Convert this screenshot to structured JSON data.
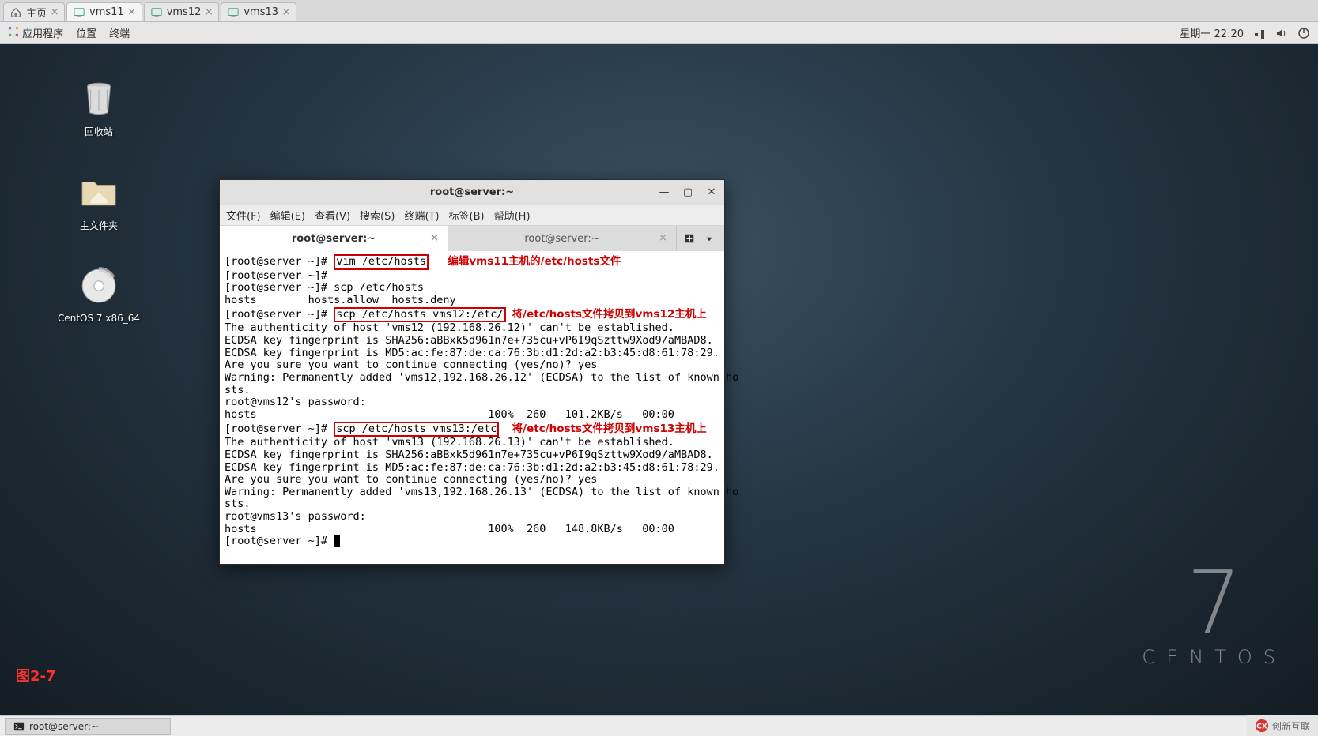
{
  "browser_tabs": [
    {
      "label": "主页",
      "icon": "home"
    },
    {
      "label": "vms11",
      "icon": "vm",
      "active": true
    },
    {
      "label": "vms12",
      "icon": "vm"
    },
    {
      "label": "vms13",
      "icon": "vm"
    }
  ],
  "top_panel": {
    "applications": "应用程序",
    "places": "位置",
    "terminal": "终端",
    "clock": "星期一 22:20"
  },
  "desktop_icons": {
    "trash": "回收站",
    "home": "主文件夹",
    "centos": "CentOS 7 x86_64"
  },
  "centos_watermark": {
    "seven": "7",
    "text": "CENTOS"
  },
  "figure_label": "图2-7",
  "terminal": {
    "title": "root@server:~",
    "menu": {
      "file": "文件(F)",
      "edit": "编辑(E)",
      "view": "查看(V)",
      "search": "搜索(S)",
      "terminal": "终端(T)",
      "tabs": "标签(B)",
      "help": "帮助(H)"
    },
    "tabs": [
      {
        "label": "root@server:~",
        "active": true
      },
      {
        "label": "root@server:~"
      }
    ],
    "prompt": "[root@server ~]#",
    "cmd1": "vim /etc/hosts",
    "anno1": "编辑vms11主机的/etc/hosts文件",
    "line_scp_partial": "[root@server ~]# scp /etc/hosts",
    "line_hosts_variants": "hosts        hosts.allow  hosts.deny",
    "cmd2": "scp /etc/hosts vms12:/etc/",
    "anno2": "将/etc/hosts文件拷贝到vms12主机上",
    "auth12": "The authenticity of host 'vms12 (192.168.26.12)' can't be established.",
    "ecdsa_sha": "ECDSA key fingerprint is SHA256:aBBxk5d961n7e+735cu+vP6I9qSzttw9Xod9/aMBAD8.",
    "ecdsa_md5": "ECDSA key fingerprint is MD5:ac:fe:87:de:ca:76:3b:d1:2d:a2:b3:45:d8:61:78:29.",
    "continue_yes": "Are you sure you want to continue connecting (yes/no)? yes",
    "warn12a": "Warning: Permanently added 'vms12,192.168.26.12' (ECDSA) to the list of known ho",
    "warn_tail": "sts.",
    "pw12": "root@vms12's password:",
    "xfer12": "hosts                                    100%  260   101.2KB/s   00:00",
    "cmd3": "scp /etc/hosts vms13:/etc",
    "anno3": "将/etc/hosts文件拷贝到vms13主机上",
    "auth13": "The authenticity of host 'vms13 (192.168.26.13)' can't be established.",
    "warn13a": "Warning: Permanently added 'vms13,192.168.26.13' (ECDSA) to the list of known ho",
    "pw13": "root@vms13's password:",
    "xfer13": "hosts                                    100%  260   148.8KB/s   00:00",
    "final_prompt": "[root@server ~]# "
  },
  "taskbar": {
    "item": "root@server:~"
  },
  "brand": "创新互联"
}
